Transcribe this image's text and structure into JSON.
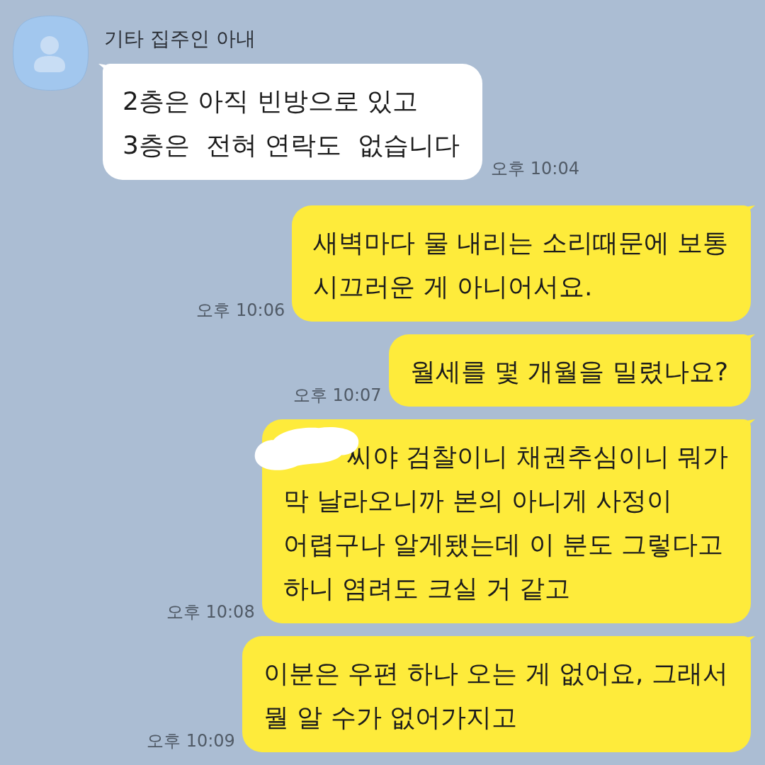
{
  "messages": [
    {
      "kind": "received",
      "sender": "기타 집주인 아내",
      "text": "2층은 아직 빈방으로 있고\n3층은  전혀 연락도  없습니다",
      "time": "오후 10:04",
      "redacted": false
    },
    {
      "kind": "sent",
      "text": "새벽마다 물 내리는 소리때문에 보통\n시끄러운 게 아니어서요.",
      "time": "오후 10:06",
      "redacted": false
    },
    {
      "kind": "sent",
      "text": "월세를 몇 개월을 밀렸나요?",
      "time": "오후 10:07",
      "redacted": false
    },
    {
      "kind": "sent",
      "text": "씨야 검찰이니 채권추심이니 뭐가\n막 날라오니까 본의 아니게 사정이\n어렵구나 알게됐는데 이 분도 그렇다고\n하니 염려도 크실 거 같고",
      "time": "오후 10:08",
      "redacted": true
    },
    {
      "kind": "sent",
      "text": "이분은 우편 하나 오는 게 없어요, 그래서\n뭘 알 수가 없어가지고",
      "time": "오후 10:09",
      "redacted": false
    }
  ]
}
